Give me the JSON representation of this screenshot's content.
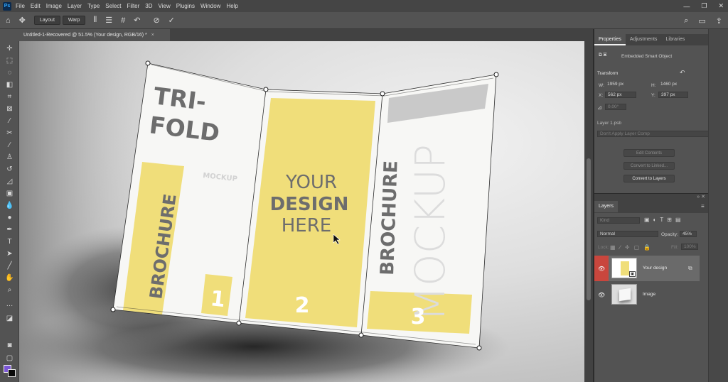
{
  "menubar": {
    "logo": "Ps",
    "items": [
      "File",
      "Edit",
      "Image",
      "Layer",
      "Type",
      "Select",
      "Filter",
      "3D",
      "View",
      "Plugins",
      "Window",
      "Help"
    ],
    "controls": [
      "—",
      "❐",
      "✕"
    ]
  },
  "options": {
    "layout_label": "Layout",
    "warp_label": "Warp"
  },
  "document": {
    "tab_title": "Untitled-1-Recovered @ 51.5% (Your design, RGB/16) *",
    "close": "×"
  },
  "artwork": {
    "panel1_title_line1": "TRI-",
    "panel1_title_line2": "FOLD",
    "panel1_mockup": "MOCKUP",
    "panel1_brochure": "BROCHURE",
    "panel1_number": "1",
    "panel2_line1": "YOUR",
    "panel2_line2": "DESIGN",
    "panel2_line3": "HERE",
    "panel2_number": "2",
    "panel3_brochure": "BROCHURE",
    "panel3_mockup": "MOCKUP",
    "panel3_number": "3",
    "yellow": "#f0de7a",
    "white": "#f7f7f5",
    "text_gray": "#6d6d6d"
  },
  "properties": {
    "tabs": [
      "Properties",
      "Adjustments",
      "Libraries"
    ],
    "type_label": "Embedded Smart Object",
    "transform_label": "Transform",
    "w_label": "W:",
    "w_value": "1959 px",
    "h_label": "H:",
    "h_value": "1460 px",
    "x_label": "X:",
    "x_value": "562 px",
    "y_label": "Y:",
    "y_value": "397 px",
    "angle_value": "0.00°",
    "file_name": "Layer 1.psb",
    "layer_comp": "Don't Apply Layer Comp",
    "edit_contents": "Edit Contents",
    "convert_linked": "Convert to Linked...",
    "convert_layers": "Convert to Layers"
  },
  "layers": {
    "tab": "Layers",
    "search_placeholder": "Kind",
    "blend_mode": "Normal",
    "opacity_label": "Opacity:",
    "opacity_value": "45%",
    "lock_label": "Lock:",
    "fill_label": "Fill:",
    "fill_value": "100%",
    "items": [
      {
        "name": "Your design",
        "selected": true
      },
      {
        "name": "Image",
        "selected": false
      }
    ]
  }
}
